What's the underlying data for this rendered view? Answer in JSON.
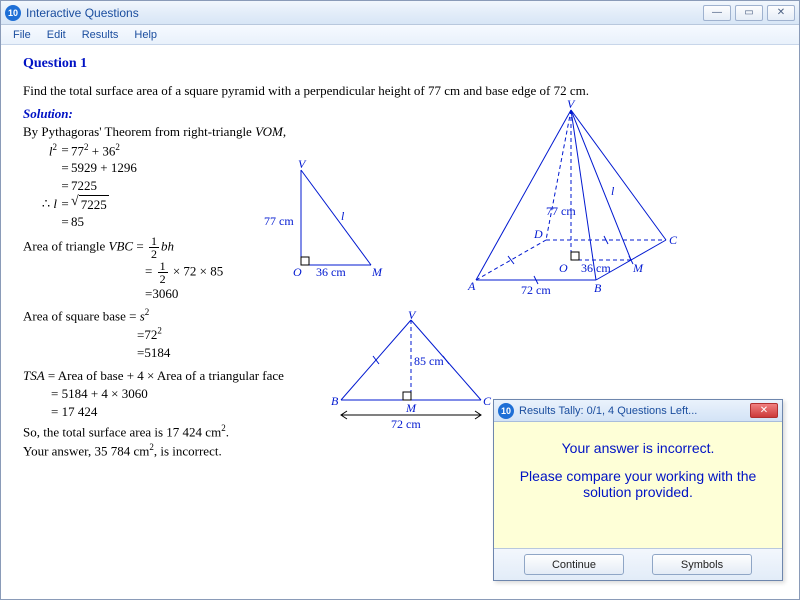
{
  "window": {
    "title": "Interactive Questions",
    "menu": [
      "File",
      "Edit",
      "Results",
      "Help"
    ]
  },
  "question": {
    "title": "Question 1",
    "prompt": "Find the total surface area of a square pyramid with a perpendicular height of 77 cm and base edge of 72 cm.",
    "solution_label": "Solution:",
    "pyth_intro": "By Pythagoras' Theorem from right-triangle ",
    "pyth_tri": "VOM",
    "l2_lhs": "l",
    "l2_sup": "2",
    "l2_rhs1": "77",
    "l2_rhs1_sup": "2",
    "l2_plus": " + ",
    "l2_rhs2": "36",
    "l2_rhs2_sup": "2",
    "l2_line2": "5929 + 1296",
    "l2_line3": "7225",
    "therefore": "∴",
    "l_eq": "l",
    "sqrt_arg": "7225",
    "l_val": "85",
    "area_tri_label": "Area of triangle ",
    "area_tri_name": "VBC",
    "half_num": "1",
    "half_den": "2",
    "bh": "bh",
    "tri_line2_after": " × 72 × 85",
    "tri_val": "3060",
    "area_base_label": "Area of square base = ",
    "s": "s",
    "s_sup": "2",
    "base_line2": "72",
    "base_line2_sup": "2",
    "base_val": "5184",
    "tsa_label": "TSA",
    "tsa_eq": " = Area of base + 4 × Area of a triangular face",
    "tsa_line2": "= 5184 + 4 × 3060",
    "tsa_line3": "= 17 424",
    "conclusion_a": "So, the total surface area is 17 424 cm",
    "conclusion_sup": "2",
    "conclusion_b": ".",
    "your_ans_a": "Your answer, 35 784 cm",
    "your_ans_sup": "2",
    "your_ans_b": ", is incorrect."
  },
  "diagram": {
    "height_label": "77 cm",
    "base_half_label": "36 cm",
    "slant_label": "l",
    "base_edge_label": "72 cm",
    "slant_val_label": "85 cm",
    "pts": {
      "V": "V",
      "O": "O",
      "M": "M",
      "A": "A",
      "B": "B",
      "C": "C",
      "D": "D"
    }
  },
  "dialog": {
    "title": "Results Tally:  0/1, 4 Questions Left...",
    "line1": "Your answer is incorrect.",
    "line2": "Please compare your working with the solution provided.",
    "btn_continue": "Continue",
    "btn_symbols": "Symbols"
  }
}
